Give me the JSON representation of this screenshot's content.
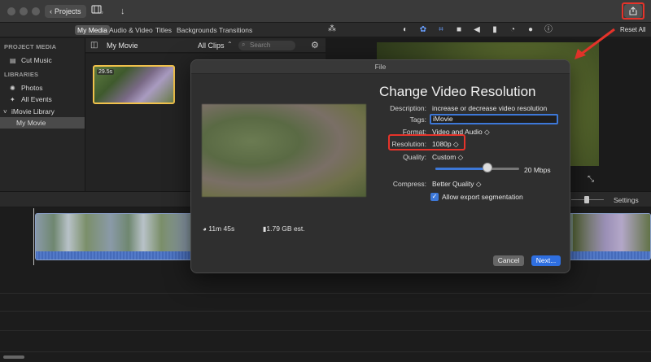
{
  "toolbar": {
    "projects_label": "Projects",
    "icons": [
      "film-strip-icon",
      "download-arrow-icon",
      "share-icon"
    ]
  },
  "media_tabs": [
    "My Media",
    "Audio & Video",
    "Titles",
    "Backgrounds",
    "Transitions"
  ],
  "viewer_toolbar": {
    "icons": [
      "color-balance-icon",
      "color-palette-icon",
      "crop-icon",
      "camera-icon",
      "volume-icon",
      "equalizer-icon",
      "speed-icon",
      "filter-icon",
      "info-icon"
    ],
    "reset_all": "Reset All"
  },
  "sidebar": {
    "project_media_heading": "PROJECT MEDIA",
    "libraries_heading": "LIBRARIES",
    "items": [
      {
        "label": "Cut Music"
      },
      {
        "label": "Photos"
      },
      {
        "label": "All Events"
      },
      {
        "label": "iMovie Library"
      },
      {
        "label": "My Movie"
      }
    ]
  },
  "browser": {
    "title": "My Movie",
    "filter": "All Clips",
    "search_placeholder": "Search",
    "thumbnail_duration": "29.5s"
  },
  "timeline": {
    "settings_label": "Settings"
  },
  "dialog": {
    "window_title": "File",
    "heading": "Change Video Resolution",
    "description_label": "Description:",
    "description_value": "increase or decrease video resolution",
    "tags_label": "Tags:",
    "tags_value": "iMovie",
    "format_label": "Format:",
    "format_value": "Video and Audio ◇",
    "resolution_label": "Resolution:",
    "resolution_value": "1080p ◇",
    "quality_label": "Quality:",
    "quality_value": "Custom ◇",
    "quality_fraction": 0.62,
    "bitrate": "20 Mbps",
    "compress_label": "Compress:",
    "compress_value": "Better Quality ◇",
    "segmentation_label": "Allow export segmentation",
    "segmentation_checked": true,
    "duration": "11m 45s",
    "size": "1.79 GB est.",
    "cancel": "Cancel",
    "next": "Next..."
  },
  "colors": {
    "accent": "#2f6fe0",
    "highlight": "#e5332a",
    "clip_border": "#f0c14b"
  }
}
